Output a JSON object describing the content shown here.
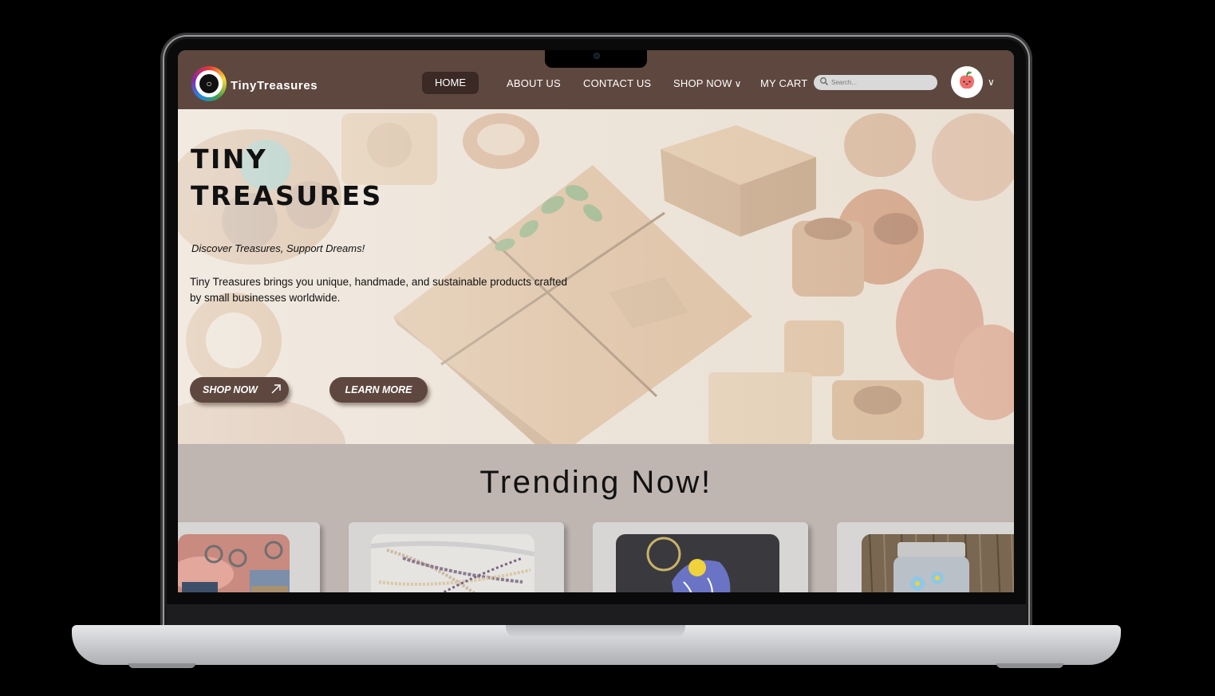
{
  "brand": {
    "name": "TinyTreasures"
  },
  "nav": {
    "home": "HOME",
    "about": "ABOUT US",
    "contact": "CONTACT US",
    "shop": "SHOP NOW",
    "cart": "MY CART",
    "chevron": "∨"
  },
  "search": {
    "placeholder": "Search..."
  },
  "hero": {
    "title_line1": "TINY",
    "title_line2": "TREASURES",
    "tagline": "Discover Treasures, Support Dreams!",
    "description": "Tiny Treasures brings you unique, handmade, and sustainable products crafted by small businesses worldwide.",
    "shop_button": "SHOP NOW",
    "learn_button": "LEARN  MORE"
  },
  "trending": {
    "title": "Trending Now!"
  },
  "colors": {
    "nav": "#5e473f",
    "nav_active": "#3a2924",
    "section_bg": "#bfb5b1",
    "card_bg": "#d8d6d5",
    "button": "#5e473f"
  },
  "icons": {
    "logo": "necklace-logo-icon",
    "search": "search-icon",
    "avatar": "apple-avatar-icon",
    "arrow": "arrow-up-right-icon"
  }
}
